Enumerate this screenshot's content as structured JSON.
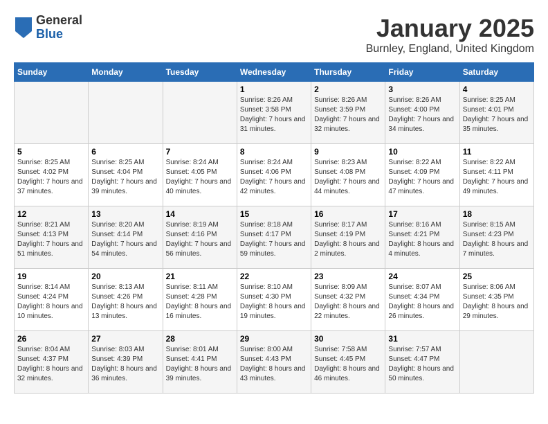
{
  "header": {
    "logo": {
      "general": "General",
      "blue": "Blue"
    },
    "title": "January 2025",
    "location": "Burnley, England, United Kingdom"
  },
  "weekdays": [
    "Sunday",
    "Monday",
    "Tuesday",
    "Wednesday",
    "Thursday",
    "Friday",
    "Saturday"
  ],
  "weeks": [
    [
      {
        "day": "",
        "sunrise": "",
        "sunset": "",
        "daylight": ""
      },
      {
        "day": "",
        "sunrise": "",
        "sunset": "",
        "daylight": ""
      },
      {
        "day": "",
        "sunrise": "",
        "sunset": "",
        "daylight": ""
      },
      {
        "day": "1",
        "sunrise": "Sunrise: 8:26 AM",
        "sunset": "Sunset: 3:58 PM",
        "daylight": "Daylight: 7 hours and 31 minutes."
      },
      {
        "day": "2",
        "sunrise": "Sunrise: 8:26 AM",
        "sunset": "Sunset: 3:59 PM",
        "daylight": "Daylight: 7 hours and 32 minutes."
      },
      {
        "day": "3",
        "sunrise": "Sunrise: 8:26 AM",
        "sunset": "Sunset: 4:00 PM",
        "daylight": "Daylight: 7 hours and 34 minutes."
      },
      {
        "day": "4",
        "sunrise": "Sunrise: 8:25 AM",
        "sunset": "Sunset: 4:01 PM",
        "daylight": "Daylight: 7 hours and 35 minutes."
      }
    ],
    [
      {
        "day": "5",
        "sunrise": "Sunrise: 8:25 AM",
        "sunset": "Sunset: 4:02 PM",
        "daylight": "Daylight: 7 hours and 37 minutes."
      },
      {
        "day": "6",
        "sunrise": "Sunrise: 8:25 AM",
        "sunset": "Sunset: 4:04 PM",
        "daylight": "Daylight: 7 hours and 39 minutes."
      },
      {
        "day": "7",
        "sunrise": "Sunrise: 8:24 AM",
        "sunset": "Sunset: 4:05 PM",
        "daylight": "Daylight: 7 hours and 40 minutes."
      },
      {
        "day": "8",
        "sunrise": "Sunrise: 8:24 AM",
        "sunset": "Sunset: 4:06 PM",
        "daylight": "Daylight: 7 hours and 42 minutes."
      },
      {
        "day": "9",
        "sunrise": "Sunrise: 8:23 AM",
        "sunset": "Sunset: 4:08 PM",
        "daylight": "Daylight: 7 hours and 44 minutes."
      },
      {
        "day": "10",
        "sunrise": "Sunrise: 8:22 AM",
        "sunset": "Sunset: 4:09 PM",
        "daylight": "Daylight: 7 hours and 47 minutes."
      },
      {
        "day": "11",
        "sunrise": "Sunrise: 8:22 AM",
        "sunset": "Sunset: 4:11 PM",
        "daylight": "Daylight: 7 hours and 49 minutes."
      }
    ],
    [
      {
        "day": "12",
        "sunrise": "Sunrise: 8:21 AM",
        "sunset": "Sunset: 4:13 PM",
        "daylight": "Daylight: 7 hours and 51 minutes."
      },
      {
        "day": "13",
        "sunrise": "Sunrise: 8:20 AM",
        "sunset": "Sunset: 4:14 PM",
        "daylight": "Daylight: 7 hours and 54 minutes."
      },
      {
        "day": "14",
        "sunrise": "Sunrise: 8:19 AM",
        "sunset": "Sunset: 4:16 PM",
        "daylight": "Daylight: 7 hours and 56 minutes."
      },
      {
        "day": "15",
        "sunrise": "Sunrise: 8:18 AM",
        "sunset": "Sunset: 4:17 PM",
        "daylight": "Daylight: 7 hours and 59 minutes."
      },
      {
        "day": "16",
        "sunrise": "Sunrise: 8:17 AM",
        "sunset": "Sunset: 4:19 PM",
        "daylight": "Daylight: 8 hours and 2 minutes."
      },
      {
        "day": "17",
        "sunrise": "Sunrise: 8:16 AM",
        "sunset": "Sunset: 4:21 PM",
        "daylight": "Daylight: 8 hours and 4 minutes."
      },
      {
        "day": "18",
        "sunrise": "Sunrise: 8:15 AM",
        "sunset": "Sunset: 4:23 PM",
        "daylight": "Daylight: 8 hours and 7 minutes."
      }
    ],
    [
      {
        "day": "19",
        "sunrise": "Sunrise: 8:14 AM",
        "sunset": "Sunset: 4:24 PM",
        "daylight": "Daylight: 8 hours and 10 minutes."
      },
      {
        "day": "20",
        "sunrise": "Sunrise: 8:13 AM",
        "sunset": "Sunset: 4:26 PM",
        "daylight": "Daylight: 8 hours and 13 minutes."
      },
      {
        "day": "21",
        "sunrise": "Sunrise: 8:11 AM",
        "sunset": "Sunset: 4:28 PM",
        "daylight": "Daylight: 8 hours and 16 minutes."
      },
      {
        "day": "22",
        "sunrise": "Sunrise: 8:10 AM",
        "sunset": "Sunset: 4:30 PM",
        "daylight": "Daylight: 8 hours and 19 minutes."
      },
      {
        "day": "23",
        "sunrise": "Sunrise: 8:09 AM",
        "sunset": "Sunset: 4:32 PM",
        "daylight": "Daylight: 8 hours and 22 minutes."
      },
      {
        "day": "24",
        "sunrise": "Sunrise: 8:07 AM",
        "sunset": "Sunset: 4:34 PM",
        "daylight": "Daylight: 8 hours and 26 minutes."
      },
      {
        "day": "25",
        "sunrise": "Sunrise: 8:06 AM",
        "sunset": "Sunset: 4:35 PM",
        "daylight": "Daylight: 8 hours and 29 minutes."
      }
    ],
    [
      {
        "day": "26",
        "sunrise": "Sunrise: 8:04 AM",
        "sunset": "Sunset: 4:37 PM",
        "daylight": "Daylight: 8 hours and 32 minutes."
      },
      {
        "day": "27",
        "sunrise": "Sunrise: 8:03 AM",
        "sunset": "Sunset: 4:39 PM",
        "daylight": "Daylight: 8 hours and 36 minutes."
      },
      {
        "day": "28",
        "sunrise": "Sunrise: 8:01 AM",
        "sunset": "Sunset: 4:41 PM",
        "daylight": "Daylight: 8 hours and 39 minutes."
      },
      {
        "day": "29",
        "sunrise": "Sunrise: 8:00 AM",
        "sunset": "Sunset: 4:43 PM",
        "daylight": "Daylight: 8 hours and 43 minutes."
      },
      {
        "day": "30",
        "sunrise": "Sunrise: 7:58 AM",
        "sunset": "Sunset: 4:45 PM",
        "daylight": "Daylight: 8 hours and 46 minutes."
      },
      {
        "day": "31",
        "sunrise": "Sunrise: 7:57 AM",
        "sunset": "Sunset: 4:47 PM",
        "daylight": "Daylight: 8 hours and 50 minutes."
      },
      {
        "day": "",
        "sunrise": "",
        "sunset": "",
        "daylight": ""
      }
    ]
  ]
}
